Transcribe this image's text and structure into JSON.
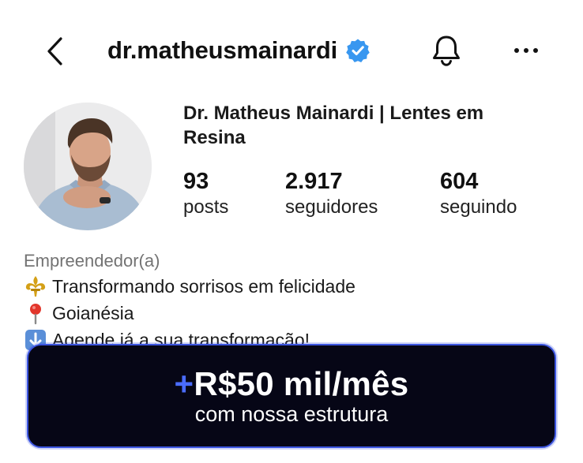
{
  "header": {
    "username": "dr.matheusmainardi"
  },
  "profile": {
    "display_name": "Dr. Matheus Mainardi | Lentes em Resina",
    "stats": [
      {
        "value": "93",
        "label": "posts"
      },
      {
        "value": "2.917",
        "label": "seguidores"
      },
      {
        "value": "604",
        "label": "seguindo"
      }
    ]
  },
  "bio": {
    "category": "Empreendedor(a)",
    "lines": [
      {
        "icon": "fleur-de-lis-icon",
        "text": "Transformando sorrisos em felicidade"
      },
      {
        "icon": "location-pin-icon",
        "text": "Goianésia"
      },
      {
        "icon": "down-arrow-icon",
        "text": "Agende já a sua transformação!"
      }
    ]
  },
  "cta": {
    "plus": "+",
    "amount": "R$50 mil/mês",
    "subtitle": "com nossa estrutura"
  },
  "colors": {
    "verified": "#3897f0",
    "cta_background": "#060616",
    "cta_border": "#3c55e0",
    "cta_plus": "#4a6cff",
    "category_text": "#737373"
  }
}
